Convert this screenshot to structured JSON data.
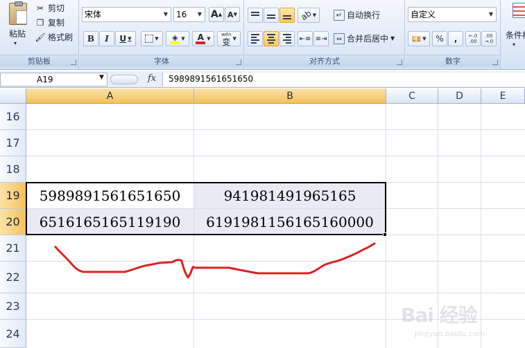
{
  "ribbon": {
    "clipboard": {
      "paste_label": "粘贴",
      "cut_label": "剪切",
      "copy_label": "复制",
      "format_painter_label": "格式刷",
      "group_label": "剪贴板"
    },
    "font": {
      "font_name": "宋体",
      "font_size": "16",
      "grow_label": "A",
      "shrink_label": "A",
      "bold_label": "B",
      "italic_label": "I",
      "underline_label": "U",
      "font_color_label": "A",
      "phonetic_label": "wén",
      "phonetic_char": "变",
      "group_label": "字体"
    },
    "alignment": {
      "wrap_text_label": "自动换行",
      "merge_center_label": "合并后居中",
      "group_label": "对齐方式"
    },
    "number": {
      "format_value": "自定义",
      "percent_label": "%",
      "comma_label": ",",
      "inc_decimal_label": "←.0 .00",
      "dec_decimal_label": ".00 →.0",
      "group_label": "数字"
    },
    "styles": {
      "conditional_format_label": "条件格"
    }
  },
  "formula_bar": {
    "name_box": "A19",
    "fx_label": "fx",
    "content": "5989891561651650"
  },
  "sheet": {
    "columns": [
      "A",
      "B",
      "C",
      "D",
      "E"
    ],
    "rows": [
      "16",
      "17",
      "18",
      "19",
      "20",
      "21",
      "22",
      "23",
      "24"
    ],
    "cells": {
      "A19": "5989891561651650",
      "B19": "941981491965165",
      "A20": "6516165165119190",
      "B20": "6191981156165160000"
    }
  },
  "watermark": {
    "logo": "Bai 经验",
    "url": "jingyan.baidu.com"
  },
  "colors": {
    "selection_header": "#f4c15d",
    "annotation_stroke": "#e02020"
  }
}
